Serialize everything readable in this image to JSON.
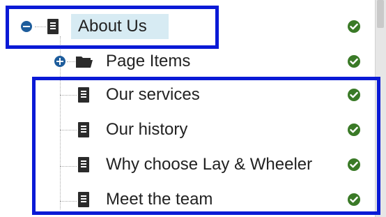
{
  "colors": {
    "highlight": "#0a1ad6",
    "toggle": "#1e5d9c",
    "check": "#3a7a27",
    "selected_row": "#d7ebf3",
    "text": "#222222"
  },
  "tree": {
    "root": {
      "label": "About Us",
      "toggle_icon": "collapse-minus-icon",
      "node_icon": "document-icon",
      "status_icon": "published-check-icon",
      "selected": true
    },
    "children": [
      {
        "label": "Page Items",
        "toggle_icon": "expand-plus-icon",
        "node_icon": "folder-icon",
        "status_icon": "published-check-icon"
      },
      {
        "label": "Our services",
        "node_icon": "document-icon",
        "status_icon": "published-check-icon"
      },
      {
        "label": "Our history",
        "node_icon": "document-icon",
        "status_icon": "published-check-icon"
      },
      {
        "label": "Why choose Lay & Wheeler",
        "node_icon": "document-icon",
        "status_icon": "published-check-icon"
      },
      {
        "label": "Meet the team",
        "node_icon": "document-icon",
        "status_icon": "published-check-icon"
      }
    ]
  }
}
